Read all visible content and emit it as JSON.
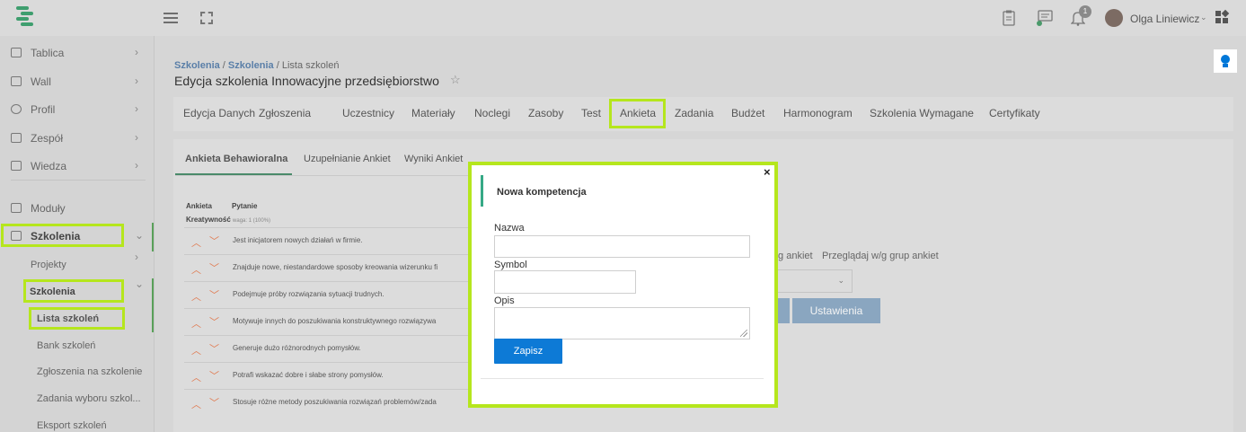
{
  "header": {
    "username": "Olga Liniewicz",
    "notification_count": "1"
  },
  "sidebar": {
    "items": [
      {
        "label": "Tablica"
      },
      {
        "label": "Wall"
      },
      {
        "label": "Profil"
      },
      {
        "label": "Zespół"
      },
      {
        "label": "Wiedza"
      },
      {
        "label": "Moduły"
      },
      {
        "label": "Szkolenia"
      }
    ],
    "subitems": [
      {
        "label": "Projekty"
      },
      {
        "label": "Szkolenia"
      },
      {
        "label": "Lista szkoleń"
      },
      {
        "label": "Bank szkoleń"
      },
      {
        "label": "Zgłoszenia na szkolenie"
      },
      {
        "label": "Zadania wyboru szkol..."
      },
      {
        "label": "Eksport szkoleń"
      }
    ]
  },
  "breadcrumb": {
    "part1": "Szkolenia",
    "sep": " / ",
    "part2": "Szkolenia",
    "part3": "Lista szkoleń"
  },
  "page_title": "Edycja szkolenia Innowacyjne przedsiębiorstwo",
  "tabs": [
    "Edycja Danych",
    "Zgłoszenia",
    "Uczestnicy",
    "Materiały",
    "Noclegi",
    "Zasoby",
    "Test",
    "Ankieta",
    "Zadania",
    "Budżet",
    "Harmonogram",
    "Szkolenia Wymagane",
    "Certyfikaty"
  ],
  "subtabs": [
    "Ankieta Behawioralna",
    "Uzupełnianie Ankiet",
    "Wyniki Ankiet"
  ],
  "survey": {
    "col_ankieta": "Ankieta",
    "col_pytanie": "Pytanie",
    "group_name": "Kreatywność",
    "group_weight": "waga: 1 (100%)",
    "questions": [
      "Jest inicjatorem nowych działań w firmie.",
      "Znajduje nowe, niestandardowe sposoby kreowania wizerunku fi",
      "Podejmuje próby rozwiązania sytuacji trudnych.",
      "Motywuje innych do poszukiwania konstruktywnego rozwiązywa",
      "Generuje dużo różnorodnych pomysłów.",
      "Potrafi wskazać dobre i słabe strony pomysłów.",
      "Stosuje różne metody poszukiwania rozwiązań problemów/zada"
    ]
  },
  "background": {
    "browse_text_1": "/g ankiet",
    "browse_text_2": "Przeglądaj w/g grup ankiet",
    "settings_button": "Ustawienia"
  },
  "modal": {
    "title": "Nowa kompetencja",
    "name_label": "Nazwa",
    "symbol_label": "Symbol",
    "description_label": "Opis",
    "save_label": "Zapisz",
    "close_glyph": "×",
    "name_value": "",
    "symbol_value": "",
    "description_value": ""
  },
  "colors": {
    "highlight": "#b5e61d",
    "accent_green": "#36a986",
    "primary_button": "#0d7ad6",
    "arrow": "#e07a50"
  }
}
